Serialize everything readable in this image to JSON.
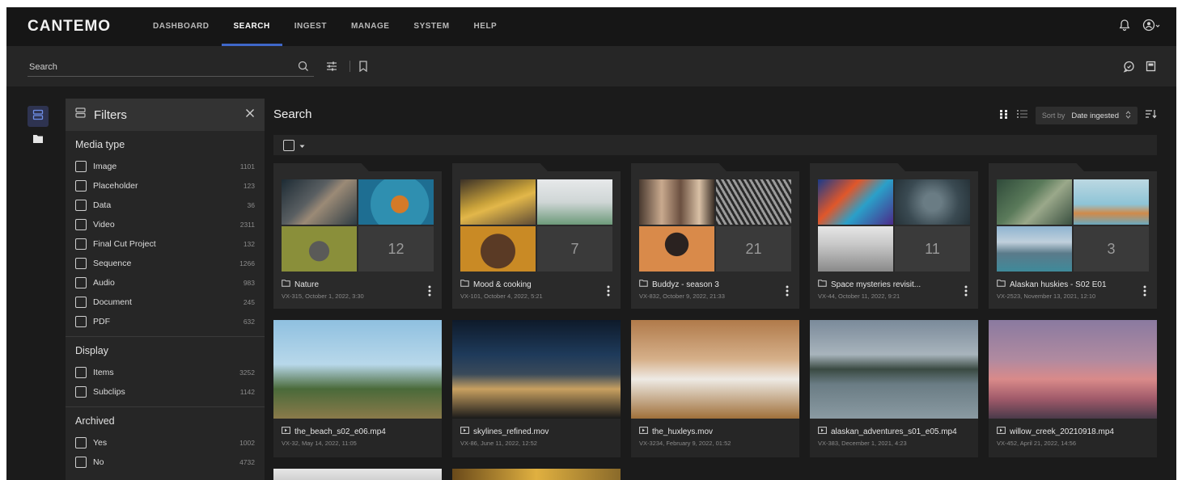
{
  "app": {
    "logo": "CANTEMO",
    "nav": [
      {
        "label": "DASHBOARD",
        "active": false
      },
      {
        "label": "SEARCH",
        "active": true
      },
      {
        "label": "INGEST",
        "active": false
      },
      {
        "label": "MANAGE",
        "active": false
      },
      {
        "label": "SYSTEM",
        "active": false
      },
      {
        "label": "HELP",
        "active": false
      }
    ]
  },
  "search": {
    "placeholder": "Search"
  },
  "filters": {
    "title": "Filters",
    "sections": [
      {
        "title": "Media type",
        "items": [
          {
            "label": "Image",
            "count": "1101"
          },
          {
            "label": "Placeholder",
            "count": "123"
          },
          {
            "label": "Data",
            "count": "36"
          },
          {
            "label": "Video",
            "count": "2311"
          },
          {
            "label": "Final Cut Project",
            "count": "132"
          },
          {
            "label": "Sequence",
            "count": "1266"
          },
          {
            "label": "Audio",
            "count": "983"
          },
          {
            "label": "Document",
            "count": "245"
          },
          {
            "label": "PDF",
            "count": "632"
          }
        ]
      },
      {
        "title": "Display",
        "items": [
          {
            "label": "Items",
            "count": "3252"
          },
          {
            "label": "Subclips",
            "count": "1142"
          }
        ]
      },
      {
        "title": "Archived",
        "items": [
          {
            "label": "Yes",
            "count": "1002"
          },
          {
            "label": "No",
            "count": "4732"
          }
        ]
      }
    ]
  },
  "main": {
    "title": "Search",
    "sort": {
      "label": "Sort by",
      "value": "Date ingested"
    }
  },
  "collections": [
    {
      "name": "Nature",
      "meta": "VX-315, October 1, 2022, 3:30",
      "count": "12"
    },
    {
      "name": "Mood & cooking",
      "meta": "VX-101, October 4, 2022, 5:21",
      "count": "7"
    },
    {
      "name": "Buddyz - season 3",
      "meta": "VX-832, October 9, 2022, 21:33",
      "count": "21"
    },
    {
      "name": "Space mysteries revisit...",
      "meta": "VX-44, October 11, 2022, 9:21",
      "count": "11"
    },
    {
      "name": "Alaskan huskies - S02 E01",
      "meta": "VX-2523, November 13, 2021, 12:10",
      "count": "3"
    }
  ],
  "assets": [
    {
      "name": "the_beach_s02_e06.mp4",
      "meta": "VX-32, May 14, 2022, 11:05"
    },
    {
      "name": "skylines_refined.mov",
      "meta": "VX-86, June 11, 2022, 12:52"
    },
    {
      "name": "the_huxleys.mov",
      "meta": "VX-3234, February 9, 2022, 01:52"
    },
    {
      "name": "alaskan_adventures_s01_e05.mp4",
      "meta": "VX-383, December 1, 2021, 4:23"
    },
    {
      "name": "willow_creek_20210918.mp4",
      "meta": "VX-452, April 21, 2022, 14:56"
    }
  ],
  "icons": {
    "bell": "bell-icon",
    "user": "user-menu-icon",
    "search": "search-icon",
    "filter": "filter-sliders-icon",
    "bookmark": "bookmark-icon",
    "chat": "chat-icon",
    "panel": "panel-icon",
    "grid": "grid-view-icon",
    "list": "list-view-icon",
    "sortdir": "sort-direction-icon"
  },
  "colors": {
    "accent": "#3f67c9",
    "background": "#1b1b1b",
    "panel": "#262626"
  }
}
